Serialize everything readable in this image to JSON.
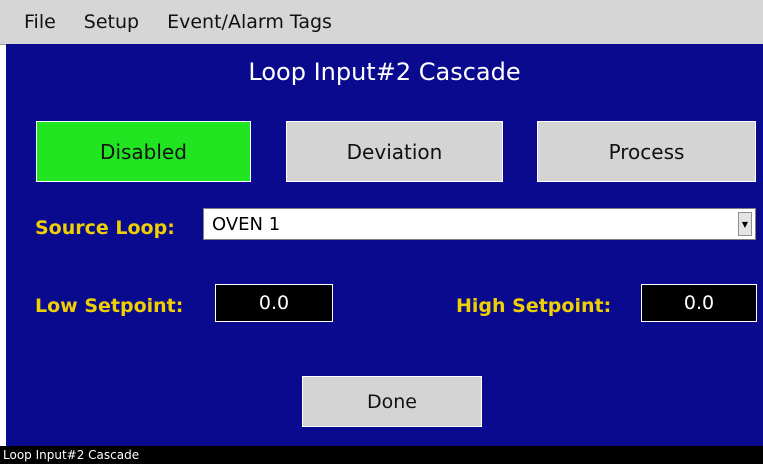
{
  "menu": {
    "items": [
      "File",
      "Setup",
      "Event/Alarm Tags"
    ]
  },
  "panel": {
    "title": "Loop Input#2 Cascade",
    "modes": [
      {
        "label": "Disabled",
        "active": true
      },
      {
        "label": "Deviation",
        "active": false
      },
      {
        "label": "Process",
        "active": false
      }
    ],
    "active_color": "#22e522",
    "background_color": "#0a0a8f",
    "label_color": "#f0d000",
    "source_loop": {
      "label": "Source Loop:",
      "value": "OVEN 1"
    },
    "low_setpoint": {
      "label": "Low Setpoint:",
      "value": "0.0"
    },
    "high_setpoint": {
      "label": "High Setpoint:",
      "value": "0.0"
    },
    "done_label": "Done"
  },
  "status": {
    "text": "Loop Input#2 Cascade"
  }
}
